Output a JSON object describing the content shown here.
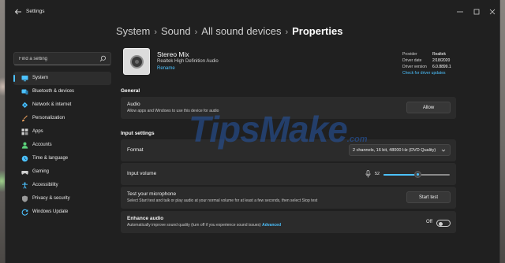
{
  "window": {
    "title": "Settings"
  },
  "sidebar": {
    "search_placeholder": "Find a setting",
    "items": [
      {
        "label": "System",
        "icon": "monitor-icon",
        "color": "#4cc2ff",
        "active": true
      },
      {
        "label": "Bluetooth & devices",
        "icon": "bluetooth-icon",
        "color": "#4cc2ff"
      },
      {
        "label": "Network & internet",
        "icon": "wifi-icon",
        "color": "#4cc2ff"
      },
      {
        "label": "Personalization",
        "icon": "brush-icon",
        "color": "#f0a35e"
      },
      {
        "label": "Apps",
        "icon": "apps-icon",
        "color": "#cfcfcf"
      },
      {
        "label": "Accounts",
        "icon": "person-icon",
        "color": "#5bd17a"
      },
      {
        "label": "Time & language",
        "icon": "clock-globe-icon",
        "color": "#4cc2ff"
      },
      {
        "label": "Gaming",
        "icon": "gamepad-icon",
        "color": "#cfcfcf"
      },
      {
        "label": "Accessibility",
        "icon": "accessibility-icon",
        "color": "#4cc2ff"
      },
      {
        "label": "Privacy & security",
        "icon": "shield-icon",
        "color": "#cfcfcf"
      },
      {
        "label": "Windows Update",
        "icon": "update-icon",
        "color": "#4cc2ff"
      }
    ]
  },
  "breadcrumb": [
    "System",
    "Sound",
    "All sound devices",
    "Properties"
  ],
  "device": {
    "name": "Stereo Mix",
    "description": "Realtek High Definition Audio",
    "rename": "Rename",
    "meta": [
      {
        "key": "Provider",
        "value": "Realtek"
      },
      {
        "key": "Driver date",
        "value": "2/18/2020"
      },
      {
        "key": "Driver version",
        "value": "6.0.8899.1"
      }
    ],
    "driver_link": "Check for driver updates"
  },
  "general": {
    "header": "General",
    "audio_title": "Audio",
    "audio_desc": "Allow apps and Windows to use this device for audio",
    "allow_button": "Allow"
  },
  "input_settings": {
    "header": "Input settings",
    "format_label": "Format",
    "format_value": "2 channels, 16 bit, 48000 Hz (DVD Quality)",
    "volume_label": "Input volume",
    "volume_value": "52",
    "volume_level": 52,
    "test_title": "Test your microphone",
    "test_desc": "Select Start test and talk or play audio at your normal volume for at least a few seconds, then select Stop test",
    "start_test": "Start test",
    "enhance_title": "Enhance audio",
    "enhance_desc": "Automatically improve sound quality (turn off if you experience sound issues)",
    "advanced_link": "Advanced",
    "enhance_state": "Off"
  },
  "watermark": {
    "text": "TipsMake",
    "suffix": ".com"
  },
  "colors": {
    "accent": "#4cc2ff",
    "window_bg": "#202020",
    "card_bg": "#2b2b2b",
    "watermark": "#2658a8"
  }
}
